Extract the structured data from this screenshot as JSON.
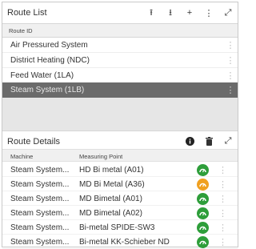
{
  "route_list": {
    "title": "Route List",
    "column_header": "Route ID",
    "icons": [
      "upload-icon",
      "download-icon",
      "plus-icon",
      "more-vertical-icon",
      "expand-icon"
    ],
    "icon_glyphs": [
      "⭱",
      "⭳",
      "+",
      "⋮",
      "⤢"
    ],
    "items": [
      {
        "label": "Air Pressured System",
        "selected": false
      },
      {
        "label": "District Heating (NDC)",
        "selected": false
      },
      {
        "label": "Feed Water (1LA)",
        "selected": false
      },
      {
        "label": "Steam System (1LB)",
        "selected": true
      }
    ]
  },
  "route_details": {
    "title": "Route Details",
    "icons": [
      "info-icon",
      "delete-icon",
      "expand-icon"
    ],
    "icon_glyphs": [
      "❶",
      "🗑",
      "⤢"
    ],
    "columns": {
      "machine": "Machine",
      "measuring_point": "Measuring Point"
    },
    "rows": [
      {
        "machine": "Steam System...",
        "point": "HD Bi metal (A01)",
        "status_color": "#2e9e3a"
      },
      {
        "machine": "Steam System...",
        "point": "MD Bi Metal (A36)",
        "status_color": "#f0a020"
      },
      {
        "machine": "Steam System...",
        "point": "MD Bimetal (A01)",
        "status_color": "#2e9e3a"
      },
      {
        "machine": "Steam System...",
        "point": "MD Bimetal (A02)",
        "status_color": "#2e9e3a"
      },
      {
        "machine": "Steam System...",
        "point": "Bi-metal SPIDE-SW3",
        "status_color": "#2e9e3a"
      },
      {
        "machine": "Steam System...",
        "point": "Bi-metal KK-Schieber ND",
        "status_color": "#2e9e3a"
      }
    ]
  },
  "colors": {
    "selected_row": "#6b6b6b",
    "status_ok": "#2e9e3a",
    "status_warning": "#f0a020"
  }
}
